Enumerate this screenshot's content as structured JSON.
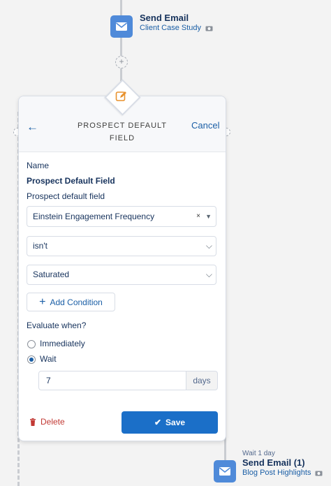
{
  "top_step": {
    "title": "Send Email",
    "link": "Client Case Study",
    "icon": "envelope-icon",
    "link_icon": "camera-icon"
  },
  "panel": {
    "back_icon": "back-arrow-icon",
    "title_line1": "PROSPECT DEFAULT",
    "title_line2": "FIELD",
    "cancel_label": "Cancel",
    "header_icon": "edit-icon",
    "name_label": "Name",
    "name_value": "Prospect Default Field",
    "field_label": "Prospect default field",
    "field_value": "Einstein Engagement Frequency",
    "clear_glyph": "×",
    "operator_value": "isn't",
    "condition_value": "Saturated",
    "add_condition_label": "Add Condition",
    "evaluate_label": "Evaluate when?",
    "options": [
      {
        "label": "Immediately",
        "selected": false
      },
      {
        "label": "Wait",
        "selected": true
      }
    ],
    "wait_value": "7",
    "wait_unit": "days",
    "delete_label": "Delete",
    "save_label": "Save"
  },
  "bottom_step": {
    "wait_label": "Wait 1 day",
    "title": "Send Email (1)",
    "link": "Blog Post Highlights",
    "icon": "envelope-icon",
    "link_icon": "camera-icon"
  },
  "colors": {
    "accent": "#1b6fc8",
    "link": "#1b5fa6",
    "email_icon_bg": "#4f8ad9",
    "delete": "#c23934",
    "edit_icon": "#e8912d"
  }
}
